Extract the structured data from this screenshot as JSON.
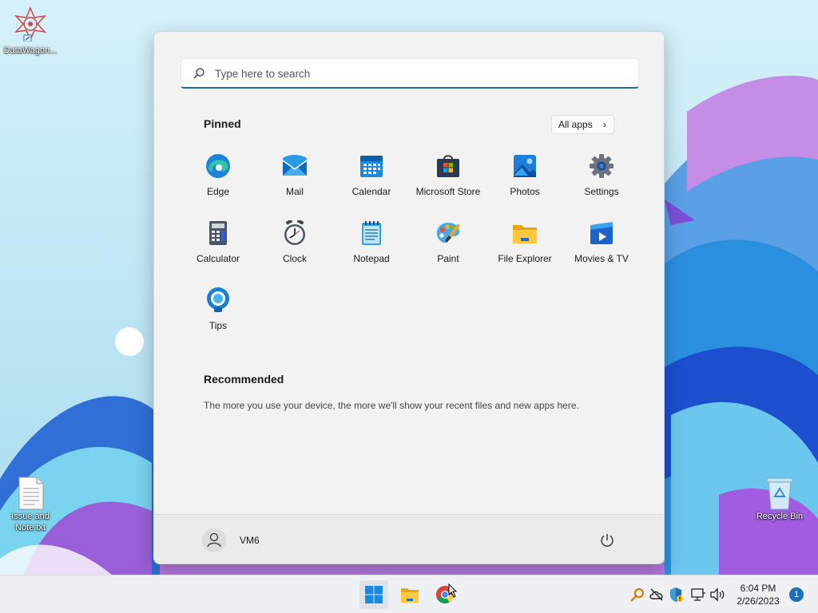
{
  "desktop": {
    "icons": [
      {
        "label": "DataWagon..."
      },
      {
        "label": "Issue and Note.txt"
      },
      {
        "label": "Recycle Bin"
      }
    ]
  },
  "start_menu": {
    "search": {
      "placeholder": "Type here to search"
    },
    "pinned": {
      "title": "Pinned",
      "all_apps_label": "All apps",
      "apps": [
        {
          "label": "Edge",
          "icon": "edge-icon"
        },
        {
          "label": "Mail",
          "icon": "mail-icon"
        },
        {
          "label": "Calendar",
          "icon": "calendar-icon"
        },
        {
          "label": "Microsoft Store",
          "icon": "store-icon"
        },
        {
          "label": "Photos",
          "icon": "photos-icon"
        },
        {
          "label": "Settings",
          "icon": "gear-icon"
        },
        {
          "label": "Calculator",
          "icon": "calculator-icon"
        },
        {
          "label": "Clock",
          "icon": "clock-icon"
        },
        {
          "label": "Notepad",
          "icon": "notepad-icon"
        },
        {
          "label": "Paint",
          "icon": "paint-palette-icon"
        },
        {
          "label": "File Explorer",
          "icon": "folder-icon"
        },
        {
          "label": "Movies & TV",
          "icon": "movies-play-icon"
        },
        {
          "label": "Tips",
          "icon": "lightbulb-icon"
        }
      ]
    },
    "recommended": {
      "title": "Recommended",
      "empty_text": "The more you use your device, the more we'll show your recent files and new apps here."
    },
    "user": {
      "name": "VM6"
    }
  },
  "taskbar": {
    "clock": {
      "time": "6:04 PM",
      "date": "2/26/2023"
    },
    "notification_count": "1"
  },
  "colors": {
    "accent": "#1f6c8f",
    "start_bg": "#f2f2f2",
    "taskbar_bg": "#eef0f3",
    "badge": "#1f6fb5"
  }
}
